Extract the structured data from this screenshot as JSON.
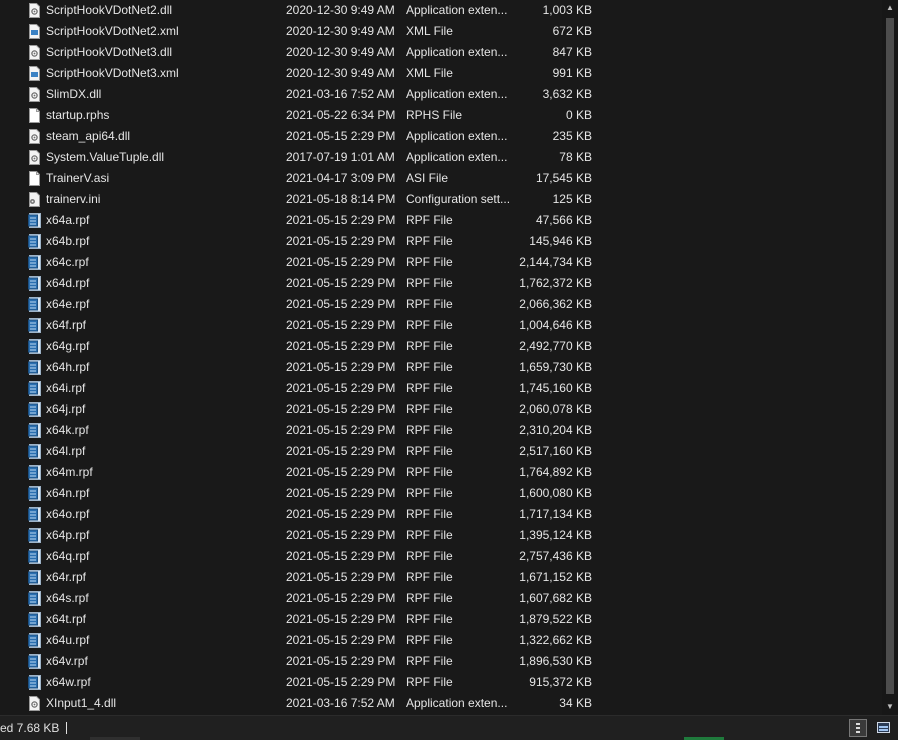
{
  "files": [
    {
      "name": "ScriptHookVDotNet2.dll",
      "date": "2020-12-30 9:49 AM",
      "type": "Application exten...",
      "size": "1,003 KB",
      "icon": "dll-icon"
    },
    {
      "name": "ScriptHookVDotNet2.xml",
      "date": "2020-12-30 9:49 AM",
      "type": "XML File",
      "size": "672 KB",
      "icon": "xml-file-icon"
    },
    {
      "name": "ScriptHookVDotNet3.dll",
      "date": "2020-12-30 9:49 AM",
      "type": "Application exten...",
      "size": "847 KB",
      "icon": "dll-icon"
    },
    {
      "name": "ScriptHookVDotNet3.xml",
      "date": "2020-12-30 9:49 AM",
      "type": "XML File",
      "size": "991 KB",
      "icon": "xml-file-icon"
    },
    {
      "name": "SlimDX.dll",
      "date": "2021-03-16 7:52 AM",
      "type": "Application exten...",
      "size": "3,632 KB",
      "icon": "dll-icon"
    },
    {
      "name": "startup.rphs",
      "date": "2021-05-22 6:34 PM",
      "type": "RPHS File",
      "size": "0 KB",
      "icon": "blank-file-icon"
    },
    {
      "name": "steam_api64.dll",
      "date": "2021-05-15 2:29 PM",
      "type": "Application exten...",
      "size": "235 KB",
      "icon": "dll-icon"
    },
    {
      "name": "System.ValueTuple.dll",
      "date": "2017-07-19 1:01 AM",
      "type": "Application exten...",
      "size": "78 KB",
      "icon": "dll-icon"
    },
    {
      "name": "TrainerV.asi",
      "date": "2021-04-17 3:09 PM",
      "type": "ASI File",
      "size": "17,545 KB",
      "icon": "blank-file-icon"
    },
    {
      "name": "trainerv.ini",
      "date": "2021-05-18 8:14 PM",
      "type": "Configuration sett...",
      "size": "125 KB",
      "icon": "config-file-icon"
    },
    {
      "name": "x64a.rpf",
      "date": "2021-05-15 2:29 PM",
      "type": "RPF File",
      "size": "47,566 KB",
      "icon": "rpf-file-icon"
    },
    {
      "name": "x64b.rpf",
      "date": "2021-05-15 2:29 PM",
      "type": "RPF File",
      "size": "145,946 KB",
      "icon": "rpf-file-icon"
    },
    {
      "name": "x64c.rpf",
      "date": "2021-05-15 2:29 PM",
      "type": "RPF File",
      "size": "2,144,734 KB",
      "icon": "rpf-file-icon"
    },
    {
      "name": "x64d.rpf",
      "date": "2021-05-15 2:29 PM",
      "type": "RPF File",
      "size": "1,762,372 KB",
      "icon": "rpf-file-icon"
    },
    {
      "name": "x64e.rpf",
      "date": "2021-05-15 2:29 PM",
      "type": "RPF File",
      "size": "2,066,362 KB",
      "icon": "rpf-file-icon"
    },
    {
      "name": "x64f.rpf",
      "date": "2021-05-15 2:29 PM",
      "type": "RPF File",
      "size": "1,004,646 KB",
      "icon": "rpf-file-icon"
    },
    {
      "name": "x64g.rpf",
      "date": "2021-05-15 2:29 PM",
      "type": "RPF File",
      "size": "2,492,770 KB",
      "icon": "rpf-file-icon"
    },
    {
      "name": "x64h.rpf",
      "date": "2021-05-15 2:29 PM",
      "type": "RPF File",
      "size": "1,659,730 KB",
      "icon": "rpf-file-icon"
    },
    {
      "name": "x64i.rpf",
      "date": "2021-05-15 2:29 PM",
      "type": "RPF File",
      "size": "1,745,160 KB",
      "icon": "rpf-file-icon"
    },
    {
      "name": "x64j.rpf",
      "date": "2021-05-15 2:29 PM",
      "type": "RPF File",
      "size": "2,060,078 KB",
      "icon": "rpf-file-icon"
    },
    {
      "name": "x64k.rpf",
      "date": "2021-05-15 2:29 PM",
      "type": "RPF File",
      "size": "2,310,204 KB",
      "icon": "rpf-file-icon"
    },
    {
      "name": "x64l.rpf",
      "date": "2021-05-15 2:29 PM",
      "type": "RPF File",
      "size": "2,517,160 KB",
      "icon": "rpf-file-icon"
    },
    {
      "name": "x64m.rpf",
      "date": "2021-05-15 2:29 PM",
      "type": "RPF File",
      "size": "1,764,892 KB",
      "icon": "rpf-file-icon"
    },
    {
      "name": "x64n.rpf",
      "date": "2021-05-15 2:29 PM",
      "type": "RPF File",
      "size": "1,600,080 KB",
      "icon": "rpf-file-icon"
    },
    {
      "name": "x64o.rpf",
      "date": "2021-05-15 2:29 PM",
      "type": "RPF File",
      "size": "1,717,134 KB",
      "icon": "rpf-file-icon"
    },
    {
      "name": "x64p.rpf",
      "date": "2021-05-15 2:29 PM",
      "type": "RPF File",
      "size": "1,395,124 KB",
      "icon": "rpf-file-icon"
    },
    {
      "name": "x64q.rpf",
      "date": "2021-05-15 2:29 PM",
      "type": "RPF File",
      "size": "2,757,436 KB",
      "icon": "rpf-file-icon"
    },
    {
      "name": "x64r.rpf",
      "date": "2021-05-15 2:29 PM",
      "type": "RPF File",
      "size": "1,671,152 KB",
      "icon": "rpf-file-icon"
    },
    {
      "name": "x64s.rpf",
      "date": "2021-05-15 2:29 PM",
      "type": "RPF File",
      "size": "1,607,682 KB",
      "icon": "rpf-file-icon"
    },
    {
      "name": "x64t.rpf",
      "date": "2021-05-15 2:29 PM",
      "type": "RPF File",
      "size": "1,879,522 KB",
      "icon": "rpf-file-icon"
    },
    {
      "name": "x64u.rpf",
      "date": "2021-05-15 2:29 PM",
      "type": "RPF File",
      "size": "1,322,662 KB",
      "icon": "rpf-file-icon"
    },
    {
      "name": "x64v.rpf",
      "date": "2021-05-15 2:29 PM",
      "type": "RPF File",
      "size": "1,896,530 KB",
      "icon": "rpf-file-icon"
    },
    {
      "name": "x64w.rpf",
      "date": "2021-05-15 2:29 PM",
      "type": "RPF File",
      "size": "915,372 KB",
      "icon": "rpf-file-icon"
    },
    {
      "name": "XInput1_4.dll",
      "date": "2021-03-16 7:52 AM",
      "type": "Application exten...",
      "size": "34 KB",
      "icon": "dll-icon"
    }
  ],
  "status": {
    "text": "ed  7.68 KB"
  },
  "colors": {
    "background": "#191919",
    "text": "#e6e6e6",
    "statusbar": "#202020",
    "rpf_icon": "#2a6fb0"
  }
}
